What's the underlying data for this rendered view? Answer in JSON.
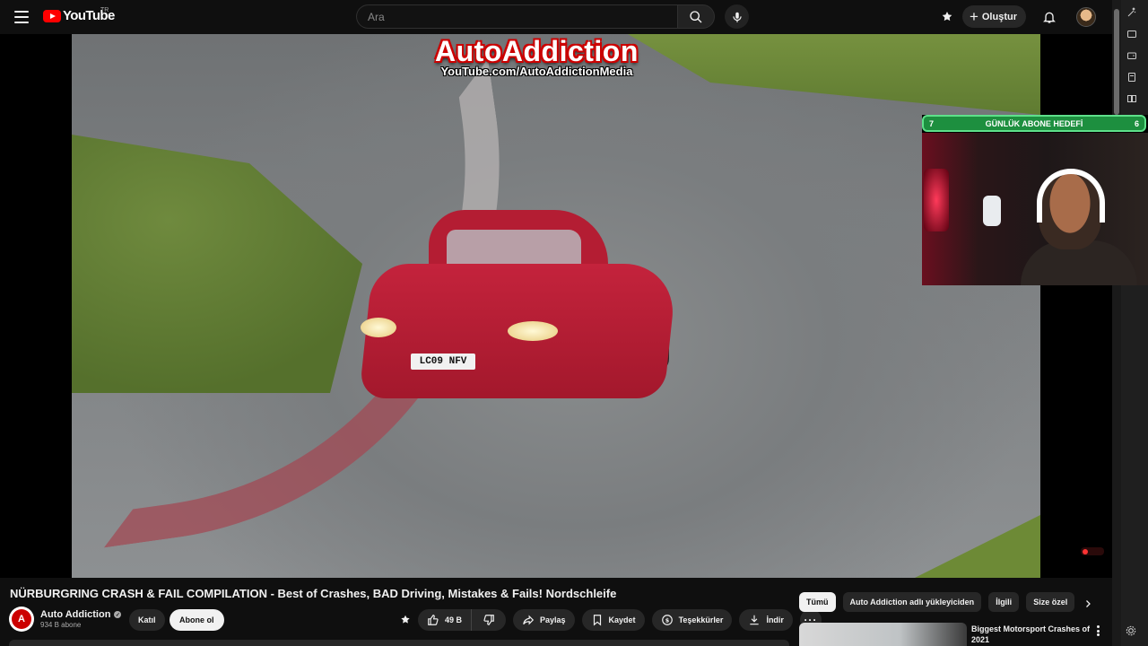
{
  "masthead": {
    "logo_text": "YouTube",
    "country_code": "TR",
    "search_placeholder": "Ara",
    "create_label": "Oluştur"
  },
  "player": {
    "brand_title": "AutoAddiction",
    "brand_url": "YouTube.com/AutoAddictionMedia",
    "plate": "LC09 NFV",
    "webcam": {
      "goal_label": "GÜNLÜK ABONE HEDEFİ",
      "goal_current": "7",
      "goal_target": "6"
    }
  },
  "video": {
    "title": "NÜRBURGRING CRASH & FAIL COMPILATION - Best of Crashes, BAD Driving, Mistakes & Fails! Nordschleife",
    "channel_name": "Auto Addiction",
    "subscriber_count": "934 B abone",
    "channel_avatar_letter": "A"
  },
  "actions": {
    "join_label": "Katıl",
    "subscribe_label": "Abone ol",
    "like_count": "49 B",
    "share_label": "Paylaş",
    "save_label": "Kaydet",
    "thanks_label": "Teşekkürler",
    "download_label": "İndir"
  },
  "chips": {
    "items": [
      {
        "label": "Tümü"
      },
      {
        "label": "Auto Addiction adlı yükleyiciden"
      },
      {
        "label": "İlgili"
      },
      {
        "label": "Size özel"
      }
    ]
  },
  "recommendation": {
    "title": "Biggest Motorsport Crashes of 2021"
  },
  "colors": {
    "background": "#0f0f0f",
    "chip_bg": "#272727",
    "brand_red": "#ff0000",
    "goal_green": "#1d8f3f"
  }
}
